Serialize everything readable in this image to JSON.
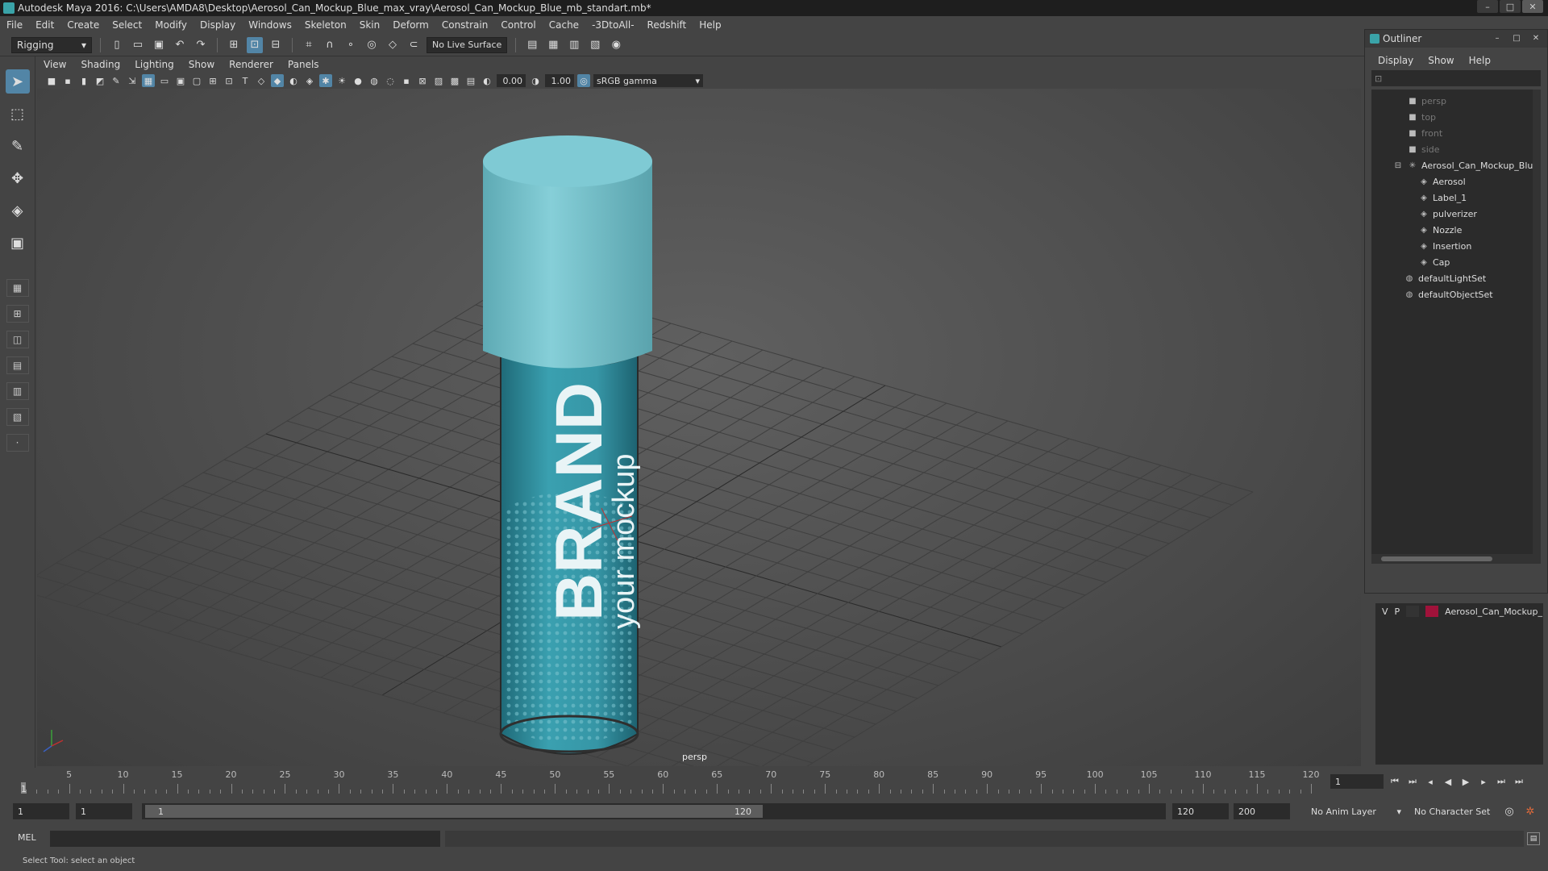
{
  "window": {
    "title": "Autodesk Maya 2016: C:\\Users\\AMDA8\\Desktop\\Aerosol_Can_Mockup_Blue_max_vray\\Aerosol_Can_Mockup_Blue_mb_standart.mb*",
    "min": "–",
    "max": "□",
    "close": "✕"
  },
  "menubar": [
    "File",
    "Edit",
    "Create",
    "Select",
    "Modify",
    "Display",
    "Windows",
    "Skeleton",
    "Skin",
    "Deform",
    "Constrain",
    "Control",
    "Cache",
    "-3DtoAll-",
    "Redshift",
    "Help"
  ],
  "statusline": {
    "menuset": "Rigging",
    "live_surface": "No Live Surface"
  },
  "panel": {
    "menus": [
      "View",
      "Shading",
      "Lighting",
      "Show",
      "Renderer",
      "Panels"
    ],
    "exposure": "0.00",
    "gamma_value": "1.00",
    "colorspace": "sRGB gamma",
    "camera_label": "persp"
  },
  "outliner": {
    "title": "Outliner",
    "menus": [
      "Display",
      "Show",
      "Help"
    ],
    "items": [
      {
        "label": "persp",
        "dim": true
      },
      {
        "label": "top",
        "dim": true
      },
      {
        "label": "front",
        "dim": true
      },
      {
        "label": "side",
        "dim": true
      },
      {
        "label": "Aerosol_Can_Mockup_Blue",
        "dim": false
      },
      {
        "label": "Aerosol",
        "dim": false
      },
      {
        "label": "Label_1",
        "dim": false
      },
      {
        "label": "pulverizer",
        "dim": false
      },
      {
        "label": "Nozzle",
        "dim": false
      },
      {
        "label": "Insertion",
        "dim": false
      },
      {
        "label": "Cap",
        "dim": false
      },
      {
        "label": "defaultLightSet",
        "dim": false
      },
      {
        "label": "defaultObjectSet",
        "dim": false
      }
    ]
  },
  "layers": {
    "v": "V",
    "p": "P",
    "name": "Aerosol_Can_Mockup_",
    "color": "#a0123a"
  },
  "timeline": {
    "ticks": [
      "5",
      "10",
      "15",
      "20",
      "25",
      "30",
      "35",
      "40",
      "45",
      "50",
      "55",
      "60",
      "65",
      "70",
      "75",
      "80",
      "85",
      "90",
      "95",
      "100",
      "105",
      "110",
      "115",
      "120"
    ],
    "start_marker": "1",
    "current_frame": "1"
  },
  "range": {
    "start": "1",
    "playback_start": "1",
    "slider_start": "1",
    "slider_end": "120",
    "playback_end": "120",
    "end": "200",
    "anim_layer": "No Anim Layer",
    "character_set": "No Character Set"
  },
  "cmdline": {
    "label": "MEL"
  },
  "help": {
    "text": "Select Tool: select an object"
  },
  "can": {
    "brand": "BRAND",
    "tagline": "your mockup",
    "cap_color": "#76c2cc",
    "body_color": "#3696a6"
  }
}
